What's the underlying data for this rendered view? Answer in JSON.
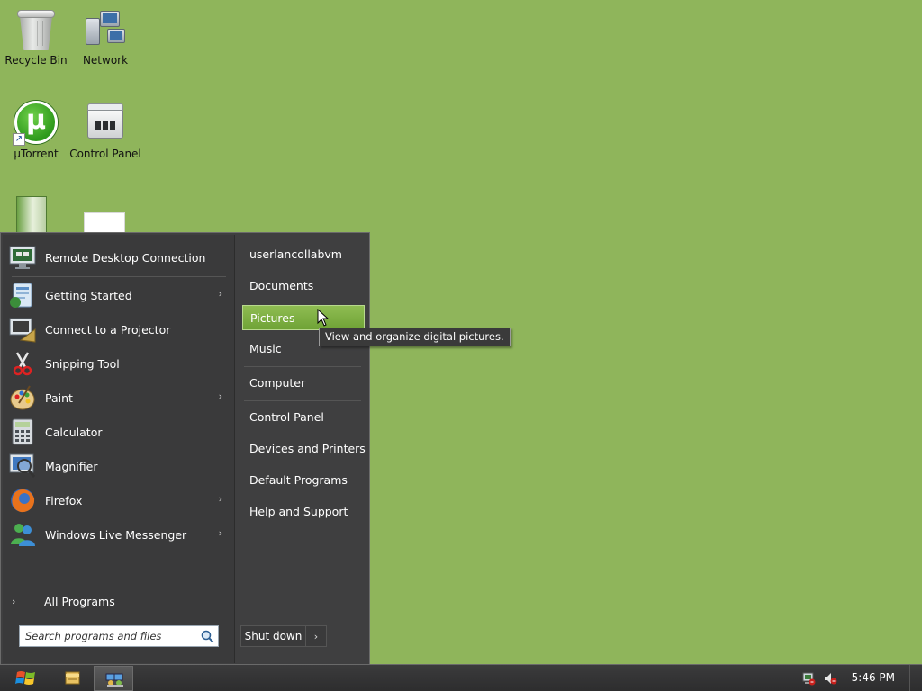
{
  "desktop": {
    "background_color": "#8fb55b",
    "icons": [
      {
        "label": "Recycle Bin",
        "icon": "recycle-bin-icon"
      },
      {
        "label": "Network",
        "icon": "network-icon"
      },
      {
        "label": "µTorrent",
        "icon": "utorrent-icon"
      },
      {
        "label": "Control Panel",
        "icon": "control-panel-icon"
      }
    ]
  },
  "start_menu": {
    "programs": [
      {
        "label": "Remote Desktop Connection",
        "icon": "remote-desktop-icon",
        "submenu": false
      },
      {
        "label": "Getting Started",
        "icon": "getting-started-icon",
        "submenu": true
      },
      {
        "label": "Connect to a Projector",
        "icon": "projector-icon",
        "submenu": false
      },
      {
        "label": "Snipping Tool",
        "icon": "scissors-icon",
        "submenu": false
      },
      {
        "label": "Paint",
        "icon": "paint-palette-icon",
        "submenu": true
      },
      {
        "label": "Calculator",
        "icon": "calculator-icon",
        "submenu": false
      },
      {
        "label": "Magnifier",
        "icon": "magnifier-icon",
        "submenu": false
      },
      {
        "label": "Firefox",
        "icon": "firefox-icon",
        "submenu": true
      },
      {
        "label": "Windows Live Messenger",
        "icon": "messenger-icon",
        "submenu": true
      }
    ],
    "all_programs_label": "All Programs",
    "search": {
      "placeholder": "Search programs and files"
    },
    "places": [
      {
        "label": "userlancollabvm",
        "highlighted": false
      },
      {
        "label": "Documents",
        "highlighted": false
      },
      {
        "label": "Pictures",
        "highlighted": true
      },
      {
        "label": "Music",
        "highlighted": false
      },
      {
        "label": "Computer",
        "highlighted": false
      },
      {
        "label": "Control Panel",
        "highlighted": false
      },
      {
        "label": "Devices and Printers",
        "highlighted": false
      },
      {
        "label": "Default Programs",
        "highlighted": false
      },
      {
        "label": "Help and Support",
        "highlighted": false
      }
    ],
    "shutdown_label": "Shut down",
    "tooltip": "View and organize digital pictures.",
    "highlight_color": "#7fb146"
  },
  "taskbar": {
    "clock": "5:46 PM",
    "pinned": [
      {
        "icon": "windows-explorer-icon"
      },
      {
        "icon": "network-connections-icon",
        "active": true
      }
    ],
    "tray": [
      {
        "icon": "network-status-icon"
      },
      {
        "icon": "volume-muted-icon"
      }
    ]
  }
}
